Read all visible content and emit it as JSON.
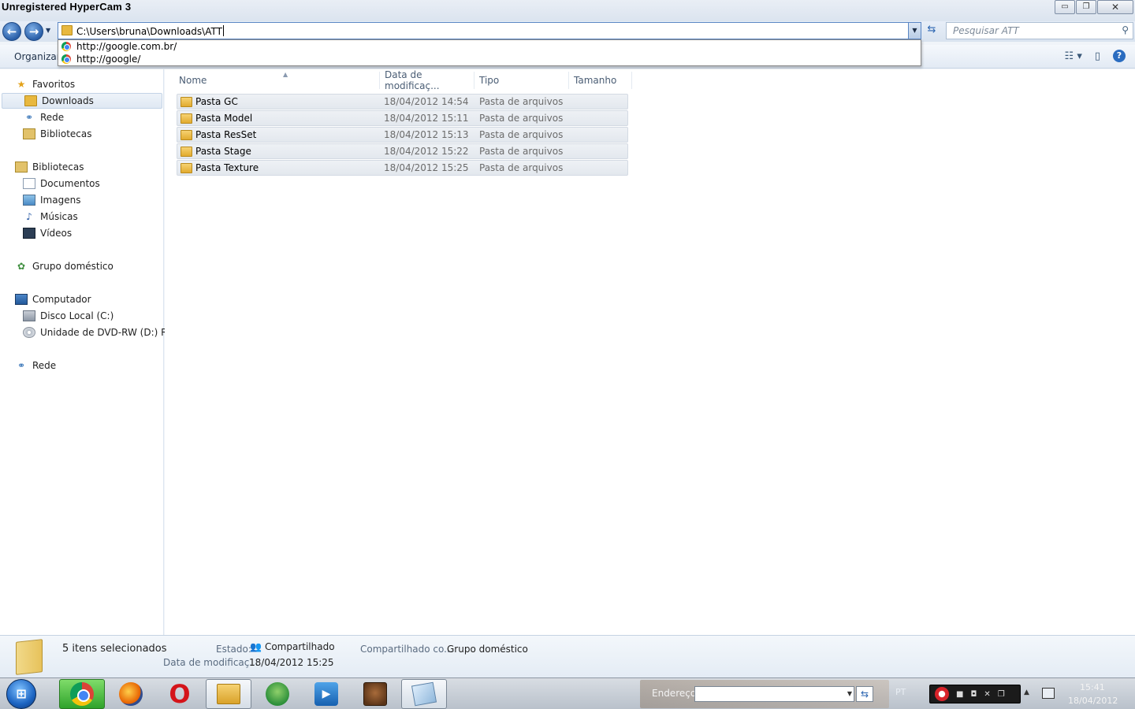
{
  "watermark": "Unregistered HyperCam 3",
  "window_buttons": {
    "minimize": "▭",
    "maximize": "❐",
    "close": "✕"
  },
  "nav": {
    "back_glyph": "←",
    "forward_glyph": "→",
    "address_value": "C:\\Users\\bruna\\Downloads\\ATT",
    "search_placeholder": "Pesquisar ATT"
  },
  "suggestions": [
    "http://google.com.br/",
    "http://google/"
  ],
  "commandbar": {
    "organize": "Organizar"
  },
  "sidebar": {
    "favoritos": "Favoritos",
    "downloads": "Downloads",
    "rede_fav": "Rede",
    "bibliotecas_fav": "Bibliotecas",
    "bibliotecas": "Bibliotecas",
    "documentos": "Documentos",
    "imagens": "Imagens",
    "musicas": "Músicas",
    "videos": "Vídeos",
    "grupo": "Grupo doméstico",
    "computador": "Computador",
    "disco_c": "Disco Local (C:)",
    "dvd": "Unidade de DVD-RW (D:) RIO",
    "rede": "Rede"
  },
  "columns": {
    "name": "Nome",
    "date": "Data de modificaç...",
    "type": "Tipo",
    "size": "Tamanho"
  },
  "files": [
    {
      "name": "Pasta GC",
      "date": "18/04/2012 14:54",
      "type": "Pasta de arquivos"
    },
    {
      "name": "Pasta Model",
      "date": "18/04/2012 15:11",
      "type": "Pasta de arquivos"
    },
    {
      "name": "Pasta ResSet",
      "date": "18/04/2012 15:13",
      "type": "Pasta de arquivos"
    },
    {
      "name": "Pasta Stage",
      "date": "18/04/2012 15:22",
      "type": "Pasta de arquivos"
    },
    {
      "name": "Pasta Texture",
      "date": "18/04/2012 15:25",
      "type": "Pasta de arquivos"
    }
  ],
  "details": {
    "count": "5 itens selecionados",
    "estado_label": "Estado:",
    "estado_value": "Compartilhado",
    "shared_label": "Compartilhado co...",
    "shared_value": "Grupo doméstico",
    "date_label": "Data de modificaç...",
    "date_value": "18/04/2012 15:25"
  },
  "taskbar": {
    "address_label": "Endereço",
    "lang": "PT",
    "time": "15:41",
    "date": "18/04/2012"
  }
}
